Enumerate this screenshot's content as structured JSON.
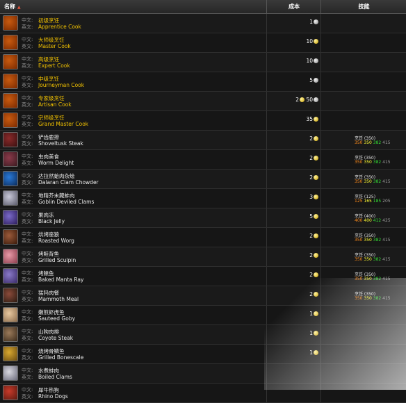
{
  "header": {
    "name": "名称",
    "sort_icon": "sort-arrow",
    "cost": "成本",
    "skill": "技能"
  },
  "lang": {
    "zh": "中文:",
    "en": "英文:"
  },
  "rows": [
    {
      "zh": "初级烹饪",
      "en": "Apprentice Cook",
      "cost": "1",
      "coin": "silver",
      "style": "gold",
      "icon": "roast-turkey-icon",
      "colors": [
        "#c85a10",
        "#7a2a00"
      ]
    },
    {
      "zh": "大师级烹饪",
      "en": "Master Cook",
      "cost": "10",
      "coin": "gold",
      "style": "gold",
      "icon": "roast-turkey-icon",
      "colors": [
        "#c85a10",
        "#7a2a00"
      ]
    },
    {
      "zh": "高级烹饪",
      "en": "Expert Cook",
      "cost": "10",
      "coin": "silver",
      "style": "gold",
      "icon": "roast-turkey-icon",
      "colors": [
        "#c85a10",
        "#7a2a00"
      ]
    },
    {
      "zh": "中级烹饪",
      "en": "Journeyman Cook",
      "cost": "5",
      "coin": "silver",
      "style": "gold",
      "icon": "roast-turkey-icon",
      "colors": [
        "#c85a10",
        "#7a2a00"
      ]
    },
    {
      "zh": "专家级烹饪",
      "en": "Artisan Cook",
      "cost": "2",
      "cost2": "50",
      "coin": "gold",
      "coin2": "silver",
      "style": "gold",
      "icon": "roast-turkey-icon",
      "colors": [
        "#c85a10",
        "#7a2a00"
      ]
    },
    {
      "zh": "宗师级烹饪",
      "en": "Grand Master Cook",
      "cost": "35",
      "coin": "gold",
      "style": "gold",
      "icon": "roast-turkey-icon",
      "colors": [
        "#c85a10",
        "#7a2a00"
      ]
    },
    {
      "zh": "铲齿鹿排",
      "en": "Shoveltusk Steak",
      "cost": "2",
      "coin": "gold",
      "style": "white",
      "icon": "steak-icon",
      "colors": [
        "#8a2a2a",
        "#3a1010"
      ],
      "skill": "烹饪 (350)",
      "s": [
        "350",
        "350",
        "382",
        "415"
      ]
    },
    {
      "zh": "虫肉美食",
      "en": "Worm Delight",
      "cost": "2",
      "coin": "gold",
      "style": "white",
      "icon": "worm-dish-icon",
      "colors": [
        "#8a3a4a",
        "#3a1a20"
      ],
      "skill": "烹饪 (350)",
      "s": [
        "350",
        "350",
        "382",
        "415"
      ]
    },
    {
      "zh": "达拉然蛤肉杂烩",
      "en": "Dalaran Clam Chowder",
      "cost": "2",
      "coin": "gold",
      "style": "white",
      "icon": "chowder-icon",
      "colors": [
        "#2a7ad8",
        "#0a2a5a"
      ],
      "skill": "烹饪 (350)",
      "s": [
        "350",
        "350",
        "382",
        "415"
      ]
    },
    {
      "zh": "地精芥末藏蚌肉",
      "en": "Goblin Deviled Clams",
      "cost": "3",
      "coin": "gold",
      "style": "white",
      "icon": "clam-icon",
      "colors": [
        "#c8c8d8",
        "#5a5a6a"
      ],
      "skill": "烹饪 (125)",
      "s": [
        "125",
        "165",
        "185",
        "205"
      ]
    },
    {
      "zh": "果肉冻",
      "en": "Black Jelly",
      "cost": "5",
      "coin": "gold",
      "style": "white",
      "icon": "jelly-icon",
      "colors": [
        "#7a6ac8",
        "#2a1a5a"
      ],
      "skill": "烹饪 (400)",
      "s": [
        "400",
        "400",
        "412",
        "425"
      ]
    },
    {
      "zh": "烘烤座狼",
      "en": "Roasted Worg",
      "cost": "2",
      "coin": "gold",
      "style": "white",
      "icon": "drumstick-icon",
      "colors": [
        "#9a5a3a",
        "#3a1a0a"
      ],
      "skill": "烹饪 (350)",
      "s": [
        "350",
        "350",
        "382",
        "415"
      ]
    },
    {
      "zh": "烤鲑背鱼",
      "en": "Grilled Sculpin",
      "cost": "2",
      "coin": "gold",
      "style": "white",
      "icon": "fish-fillet-icon",
      "colors": [
        "#e89aa8",
        "#8a3a4a"
      ],
      "skill": "烹饪 (350)",
      "s": [
        "350",
        "350",
        "382",
        "415"
      ]
    },
    {
      "zh": "烤鲼鱼",
      "en": "Baked Manta Ray",
      "cost": "2",
      "coin": "gold",
      "style": "white",
      "icon": "manta-ray-icon",
      "colors": [
        "#8a7ac8",
        "#3a2a6a"
      ],
      "skill": "烹饪 (350)",
      "s": [
        "350",
        "350",
        "382",
        "415"
      ]
    },
    {
      "zh": "猛犸肉餐",
      "en": "Mammoth Meal",
      "cost": "2",
      "coin": "gold",
      "style": "white",
      "icon": "meat-leg-icon",
      "colors": [
        "#8a4a3a",
        "#2a1a10"
      ],
      "skill": "烹饪 (350)",
      "s": [
        "350",
        "350",
        "382",
        "415"
      ]
    },
    {
      "zh": "嫩煎虾虎鱼",
      "en": "Sauteed Goby",
      "cost": "1",
      "coin": "gold",
      "style": "white",
      "icon": "goby-icon",
      "colors": [
        "#e8c8a0",
        "#8a6a4a"
      ]
    },
    {
      "zh": "山狗肉排",
      "en": "Coyote Steak",
      "cost": "1",
      "coin": "gold",
      "style": "white",
      "icon": "coyote-steak-icon",
      "colors": [
        "#9a7a5a",
        "#3a2a1a"
      ]
    },
    {
      "zh": "烧烤骨鳞鱼",
      "en": "Grilled Bonescale",
      "cost": "1",
      "coin": "gold",
      "style": "white",
      "icon": "bonescale-icon",
      "colors": [
        "#d8a830",
        "#6a4a10"
      ]
    },
    {
      "zh": "水煮蚌肉",
      "en": "Boiled Clams",
      "cost": "",
      "coin": "",
      "style": "white",
      "icon": "boiled-clam-icon",
      "colors": [
        "#d8d8e0",
        "#6a6a7a"
      ]
    },
    {
      "zh": "犀牛热狗",
      "en": "Rhino Dogs",
      "cost": "",
      "coin": "",
      "style": "white",
      "icon": "hotdog-icon",
      "colors": [
        "#c83a2a",
        "#5a1a10"
      ]
    }
  ]
}
